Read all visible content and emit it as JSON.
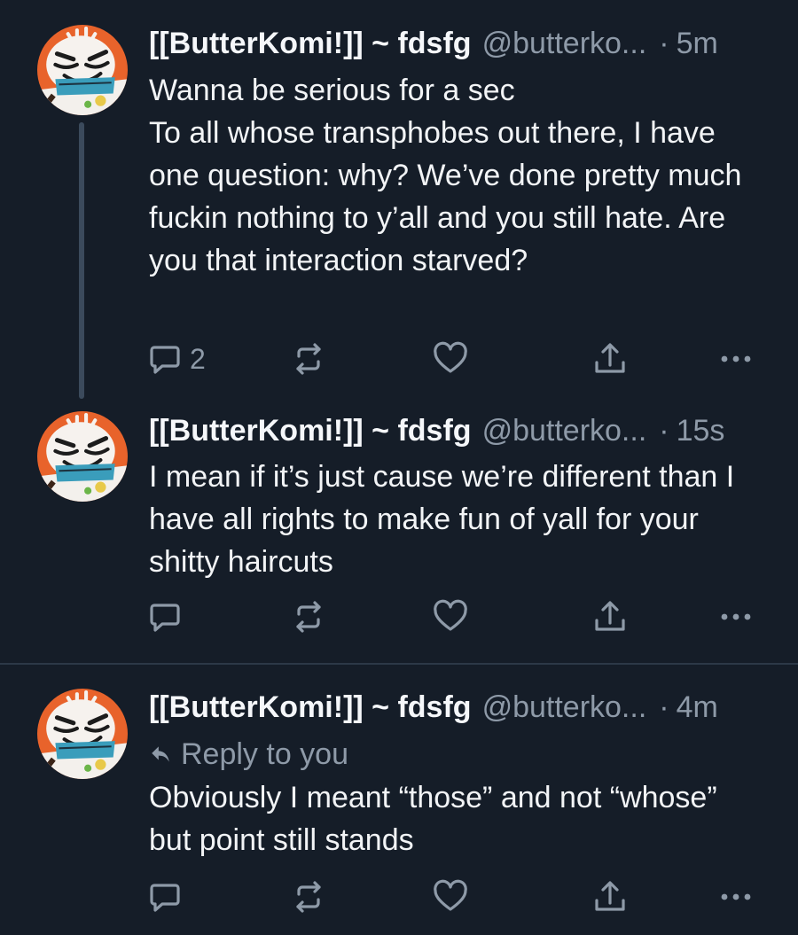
{
  "posts": [
    {
      "author": "[[ButterKomi!]] ~ fdsfg",
      "handle": "@butterko...",
      "separator": "·",
      "time": "5m",
      "body": "Wanna be serious for a sec\nTo all whose transphobes out there, I have one question: why? We’ve done pretty much fuckin nothing to y’all and you still hate. Are you that interaction starved?",
      "reply_count": "2"
    },
    {
      "author": "[[ButterKomi!]] ~ fdsfg",
      "handle": "@butterko...",
      "separator": "·",
      "time": "15s",
      "body": "I mean if it’s just cause we’re different than I have all rights to make fun of yall for your shitty haircuts",
      "reply_count": ""
    },
    {
      "author": "[[ButterKomi!]] ~ fdsfg",
      "handle": "@butterko...",
      "separator": "·",
      "time": "4m",
      "reply_label": "Reply to you",
      "body": "Obviously I meant “those” and not “whose” but point still stands",
      "reply_count": ""
    }
  ],
  "icons": {
    "reply": "speech-bubble-icon",
    "repost": "repost-arrows-icon",
    "like": "heart-icon",
    "share": "share-upload-icon",
    "more": "ellipsis-icon",
    "reply_to": "reply-arrow-icon"
  },
  "colors": {
    "background": "#151d28",
    "text": "#f2f4f6",
    "secondary": "#8e9aa8",
    "avatar_orange": "#e8632b"
  }
}
